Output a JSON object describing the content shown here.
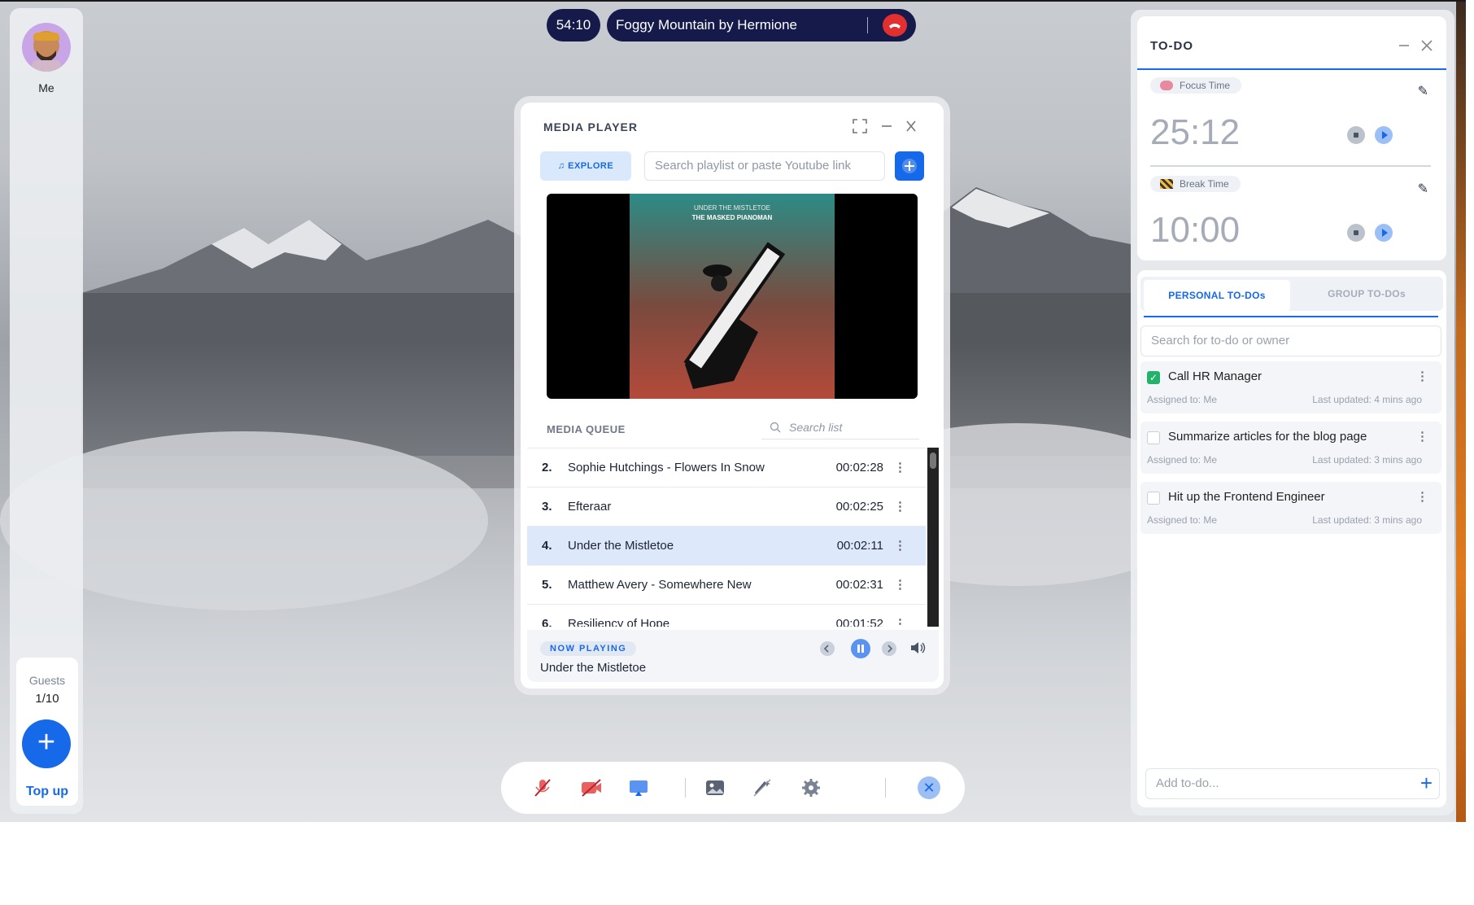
{
  "call": {
    "elapsed": "54:10",
    "room_title": "Foggy Mountain by Hermione"
  },
  "left_rail": {
    "me_label": "Me",
    "guests_label": "Guests",
    "guests_count": "1/10",
    "top_up_label": "Top up"
  },
  "media_player": {
    "title": "MEDIA PLAYER",
    "explore_label": "EXPLORE",
    "search_placeholder": "Search playlist or paste Youtube link",
    "video": {
      "line1": "UNDER THE MISTLETOE",
      "line2": "THE MASKED PIANOMAN"
    },
    "queue_label": "MEDIA QUEUE",
    "queue_search_placeholder": "Search list",
    "queue": [
      {
        "num": "2.",
        "name": "Sophie Hutchings - Flowers In Snow",
        "time": "00:02:28",
        "active": false
      },
      {
        "num": "3.",
        "name": "Efteraar",
        "time": "00:02:25",
        "active": false
      },
      {
        "num": "4.",
        "name": "Under the Mistletoe",
        "time": "00:02:11",
        "active": true
      },
      {
        "num": "5.",
        "name": "Matthew Avery - Somewhere New",
        "time": "00:02:31",
        "active": false
      },
      {
        "num": "6.",
        "name": "Resiliency of Hope",
        "time": "00:01:52",
        "active": false
      }
    ],
    "now_playing_label": "NOW PLAYING",
    "now_playing_title": "Under the Mistletoe"
  },
  "todo_panel": {
    "title": "TO-DO",
    "focus": {
      "label": "Focus Time",
      "time": "25:12"
    },
    "break": {
      "label": "Break Time",
      "time": "10:00"
    }
  },
  "todo_list": {
    "tab_personal": "PERSONAL TO-DOs",
    "tab_group": "GROUP TO-DOs",
    "search_placeholder": "Search for to-do or owner",
    "items": [
      {
        "title": "Call HR Manager",
        "assigned": "Assigned to: Me",
        "updated": "Last updated: 4 mins ago",
        "done": true
      },
      {
        "title": "Summarize articles for the blog page",
        "assigned": "Assigned to: Me",
        "updated": "Last updated: 3 mins ago",
        "done": false
      },
      {
        "title": "Hit up the Frontend Engineer",
        "assigned": "Assigned to: Me",
        "updated": "Last updated: 3 mins ago",
        "done": false
      }
    ],
    "add_placeholder": "Add to-do..."
  },
  "colors": {
    "accent": "#1669e8",
    "call_bar": "#151a4a",
    "hangup": "#e23030",
    "done_check": "#22b26a"
  },
  "icons": {
    "toolbar": [
      "mic-off-icon",
      "camera-off-icon",
      "screen-share-icon",
      "background-icon",
      "effects-off-icon",
      "gear-icon",
      "close-icon"
    ]
  }
}
